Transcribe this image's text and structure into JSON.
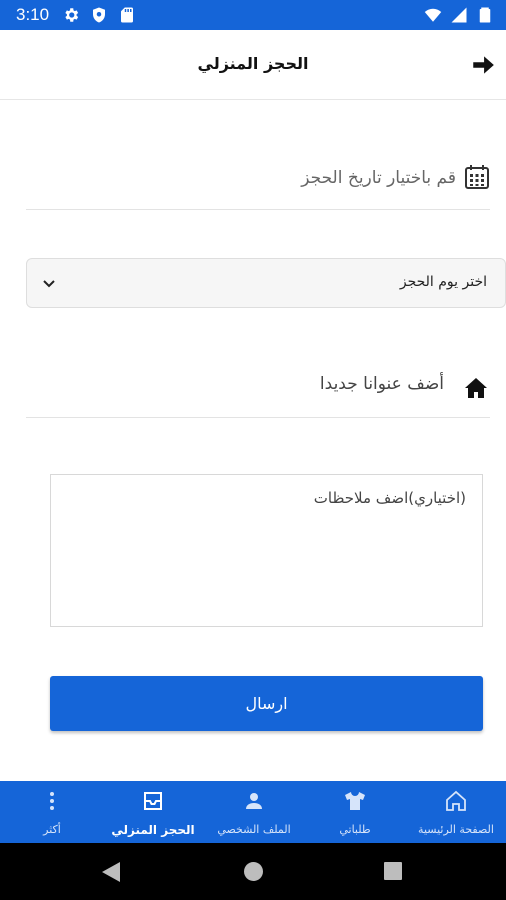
{
  "status_bar": {
    "time": "3:10",
    "left_icons": [
      "gear-icon",
      "shield-icon",
      "sd-card-icon"
    ],
    "right_icons": [
      "wifi-icon",
      "signal-icon",
      "battery-icon"
    ]
  },
  "header": {
    "title": "الحجز المنزلي",
    "back_icon": "arrow-right-icon"
  },
  "form": {
    "date_label": "قم باختيار تاريخ الحجز",
    "day_select_value": "اختر يوم الحجز",
    "address_label": "أضف عنوانا جديدا",
    "notes_placeholder": "(اختياري)اضف ملاحظات",
    "submit_label": "ارسال"
  },
  "bottom_nav": {
    "items": [
      {
        "label": "الصفحة الرئيسية",
        "icon": "home-outline-icon",
        "active": false
      },
      {
        "label": "طلباتي",
        "icon": "shirt-icon",
        "active": false
      },
      {
        "label": "الملف الشخصي",
        "icon": "person-icon",
        "active": false
      },
      {
        "label": "الحجز المنزلي",
        "icon": "inbox-icon",
        "active": true
      },
      {
        "label": "أكثر",
        "icon": "more-vertical-icon",
        "active": false
      }
    ]
  },
  "colors": {
    "primary": "#1565d8",
    "nav_bar": "#000000"
  }
}
